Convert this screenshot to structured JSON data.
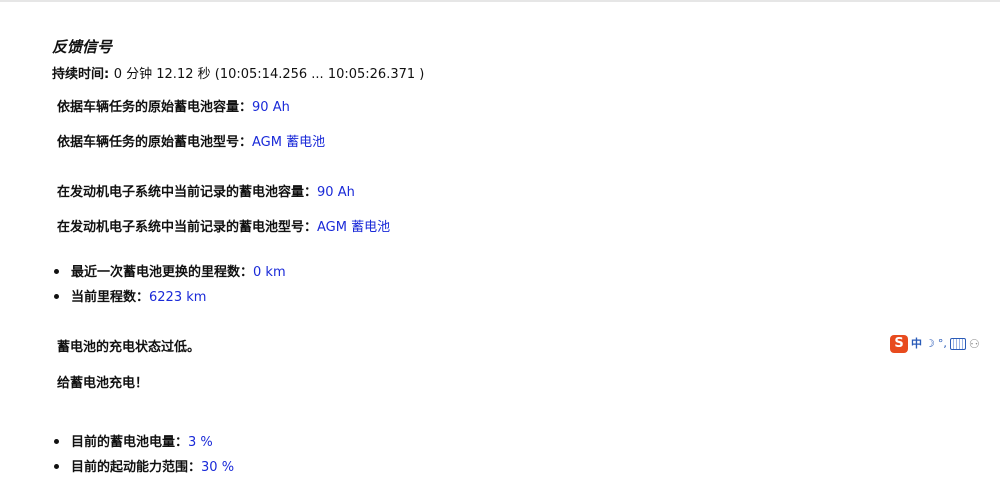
{
  "title": "反馈信号",
  "duration": {
    "label": "持续时间: ",
    "value": "0 分钟 12.12 秒 (10:05:14.256 ... 10:05:26.371 )"
  },
  "lines": [
    {
      "label": "依据车辆任务的原始蓄电池容量：",
      "value": "90 Ah"
    },
    {
      "label": "依据车辆任务的原始蓄电池型号：",
      "value": "AGM 蓄电池"
    },
    {
      "label": "在发动机电子系统中当前记录的蓄电池容量：",
      "value": "90 Ah"
    },
    {
      "label": "在发动机电子系统中当前记录的蓄电池型号：",
      "value": "AGM 蓄电池"
    }
  ],
  "bullets_mileage": [
    {
      "label": "最近一次蓄电池更换的里程数：",
      "value": "0 km"
    },
    {
      "label": "当前里程数：",
      "value": "6223 km"
    }
  ],
  "messages": {
    "low_charge": "蓄电池的充电状态过低。",
    "charge_action": "给蓄电池充电！"
  },
  "bullets_status": [
    {
      "label": "目前的蓄电池电量：",
      "value": "3 %"
    },
    {
      "label": "目前的起动能力范围：",
      "value": "30 %"
    }
  ],
  "ime_toolbar": {
    "logo": "S",
    "mode": "中",
    "moon": "☽",
    "punct": "°,",
    "user": "⚇",
    "icons": [
      "sogou-logo-icon",
      "moon-icon",
      "punctuation-icon",
      "keyboard-icon",
      "user-icon"
    ],
    "accent": "#e84b1e"
  },
  "colors": {
    "value_blue": "#1a2ad8",
    "text": "#111111"
  }
}
